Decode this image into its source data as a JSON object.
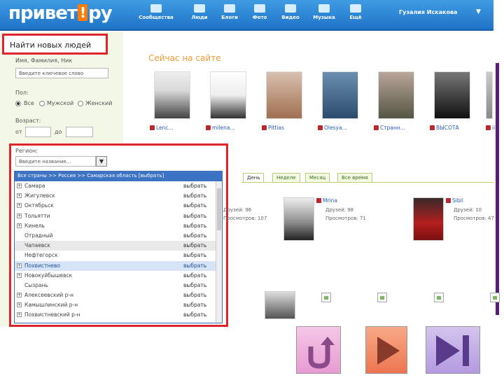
{
  "header": {
    "logo_left": "привет",
    "logo_bang": "!",
    "logo_right": "ру",
    "nav": [
      {
        "label": "Сообщества",
        "icon": "communities-icon"
      },
      {
        "label": "Люди",
        "icon": "people-icon"
      },
      {
        "label": "Блоги",
        "icon": "blogs-icon"
      },
      {
        "label": "Фото",
        "icon": "photo-icon"
      },
      {
        "label": "Видео",
        "icon": "video-icon"
      },
      {
        "label": "Музыка",
        "icon": "music-icon"
      },
      {
        "label": "Ещё",
        "icon": "more-icon"
      }
    ],
    "user_name": "Гузалия Искакова",
    "user_arrow": "▼"
  },
  "search": {
    "title": "Найти новых людей",
    "name_label": "Имя, Фамилия, Ник",
    "name_placeholder": "Введите ключевое слово",
    "gender_label": "Пол:",
    "gender_options": [
      "Все",
      "Мужской",
      "Женский"
    ],
    "age_label": "Возраст:",
    "age_from": "от",
    "age_to": "до",
    "region_label": "Регион:",
    "region_placeholder": "Введите название...",
    "region_dd_arrow": "▼",
    "region_path": "Все страны >> Россия >> Самарская область [выбрать]",
    "regions": [
      {
        "name": "Самара",
        "pick": "выбрать",
        "expandable": true
      },
      {
        "name": "Жигулевск",
        "pick": "выбрать",
        "expandable": true
      },
      {
        "name": "Октябрьск",
        "pick": "выбрать",
        "expandable": true
      },
      {
        "name": "Тольятти",
        "pick": "выбрать",
        "expandable": true
      },
      {
        "name": "Кинель",
        "pick": "выбрать",
        "expandable": true
      },
      {
        "name": "Отрадный",
        "pick": "выбрать",
        "expandable": false
      },
      {
        "name": "Чапаевск",
        "pick": "выбрать",
        "expandable": false
      },
      {
        "name": "Нефтегорск",
        "pick": "выбрать",
        "expandable": false
      },
      {
        "name": "Похвистнево",
        "pick": "выбрать",
        "expandable": true
      },
      {
        "name": "Новокуйбышевск",
        "pick": "выбрать",
        "expandable": true
      },
      {
        "name": "Сызрань",
        "pick": "выбрать",
        "expandable": false
      },
      {
        "name": "Алексеевский р-н",
        "pick": "выбрать",
        "expandable": true
      },
      {
        "name": "Камышлинский р-н",
        "pick": "выбрать",
        "expandable": true
      },
      {
        "name": "Похвистневский р-н",
        "pick": "выбрать",
        "expandable": true
      }
    ],
    "selected_index": 8,
    "gray_index": 6
  },
  "online": {
    "title": "Сейчас на сайте",
    "users": [
      "Lenc...",
      "milena...",
      "Pittias",
      "Olesya...",
      "Странн...",
      "ВЫСОТА",
      "ii"
    ]
  },
  "tabs": [
    "День",
    "Неделе",
    "Месяц",
    "Все время"
  ],
  "top_users": [
    {
      "name": "",
      "friends": "Друзей: 96",
      "views": "Просмотров: 107"
    },
    {
      "name": "Mrina",
      "friends": "Друзей: 98",
      "views": "Просмотров: 71"
    },
    {
      "name": "Sibil",
      "friends": "Друзей: 10",
      "views": "Просмотров: 47"
    }
  ],
  "colors": {
    "header_blue": "#2b86d6",
    "accent_orange": "#f39a34",
    "highlight_red": "#e0242b",
    "link_blue": "#2a5db0"
  },
  "slide_buttons": [
    "back-icon",
    "play-icon",
    "end-icon"
  ]
}
